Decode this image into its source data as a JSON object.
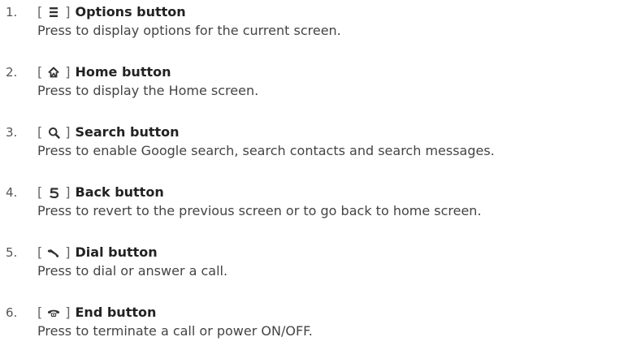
{
  "items": [
    {
      "number": "1.",
      "icon": "options-icon",
      "title": "Options button",
      "description": "Press to display options for the current screen."
    },
    {
      "number": "2.",
      "icon": "home-icon",
      "title": "Home button",
      "description": "Press to display the Home screen."
    },
    {
      "number": "3.",
      "icon": "search-icon",
      "title": "Search button",
      "description": "Press to enable Google search, search contacts and search messages."
    },
    {
      "number": "4.",
      "icon": "back-icon",
      "title": "Back button",
      "description": "Press to revert to the previous screen or to go back to home screen."
    },
    {
      "number": "5.",
      "icon": "dial-icon",
      "title": "Dial button",
      "description": "Press to dial or answer a call."
    },
    {
      "number": "6.",
      "icon": "end-call-icon",
      "title": "End button",
      "description": "Press to terminate a call or power ON/OFF."
    }
  ],
  "brackets": {
    "open": "[",
    "close": "]"
  }
}
